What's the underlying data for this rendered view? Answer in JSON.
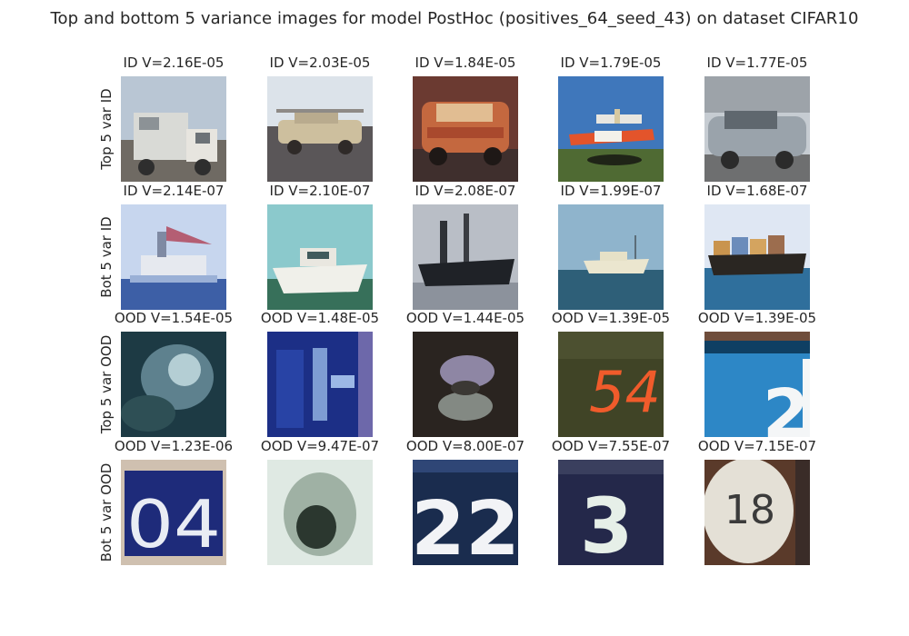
{
  "chart_data": {
    "type": "image-grid",
    "title": "Top and bottom 5 variance images for model PostHoc (positives_64_seed_43) on dataset CIFAR10",
    "rows": [
      {
        "label": "Top 5 var ID",
        "images": [
          {
            "caption": "ID V=2.16E-05",
            "subject": "truck-icon"
          },
          {
            "caption": "ID V=2.03E-05",
            "subject": "car-icon"
          },
          {
            "caption": "ID V=1.84E-05",
            "subject": "car-icon"
          },
          {
            "caption": "ID V=1.79E-05",
            "subject": "airplane-icon"
          },
          {
            "caption": "ID V=1.77E-05",
            "subject": "car-icon"
          }
        ]
      },
      {
        "label": "Bot 5 var ID",
        "images": [
          {
            "caption": "ID V=2.14E-07",
            "subject": "ship-icon"
          },
          {
            "caption": "ID V=2.10E-07",
            "subject": "ship-icon"
          },
          {
            "caption": "ID V=2.08E-07",
            "subject": "ship-icon"
          },
          {
            "caption": "ID V=1.99E-07",
            "subject": "ship-icon"
          },
          {
            "caption": "ID V=1.68E-07",
            "subject": "ship-icon"
          }
        ]
      },
      {
        "label": "Top 5 var OOD",
        "images": [
          {
            "caption": "OOD V=1.54E-05",
            "subject": "blurry-digit-icon"
          },
          {
            "caption": "OOD V=1.48E-05",
            "subject": "blurry-digit-icon"
          },
          {
            "caption": "OOD V=1.44E-05",
            "subject": "blurry-digit-icon"
          },
          {
            "caption": "OOD V=1.39E-05",
            "subject": "house-number-icon"
          },
          {
            "caption": "OOD V=1.39E-05",
            "subject": "house-number-icon"
          }
        ]
      },
      {
        "label": "Bot 5 var OOD",
        "images": [
          {
            "caption": "OOD V=1.23E-06",
            "subject": "house-number-icon"
          },
          {
            "caption": "OOD V=9.47E-07",
            "subject": "blurry-digit-icon"
          },
          {
            "caption": "OOD V=8.00E-07",
            "subject": "house-number-icon"
          },
          {
            "caption": "OOD V=7.55E-07",
            "subject": "house-number-icon"
          },
          {
            "caption": "OOD V=7.15E-07",
            "subject": "house-number-icon"
          }
        ]
      }
    ],
    "variances": [
      [
        2.16e-05,
        2.03e-05,
        1.84e-05,
        1.79e-05,
        1.77e-05
      ],
      [
        2.14e-07,
        2.1e-07,
        2.08e-07,
        1.99e-07,
        1.68e-07
      ],
      [
        1.54e-05,
        1.48e-05,
        1.44e-05,
        1.39e-05,
        1.39e-05
      ],
      [
        1.23e-06,
        9.47e-07,
        8e-07,
        7.55e-07,
        7.15e-07
      ]
    ]
  }
}
